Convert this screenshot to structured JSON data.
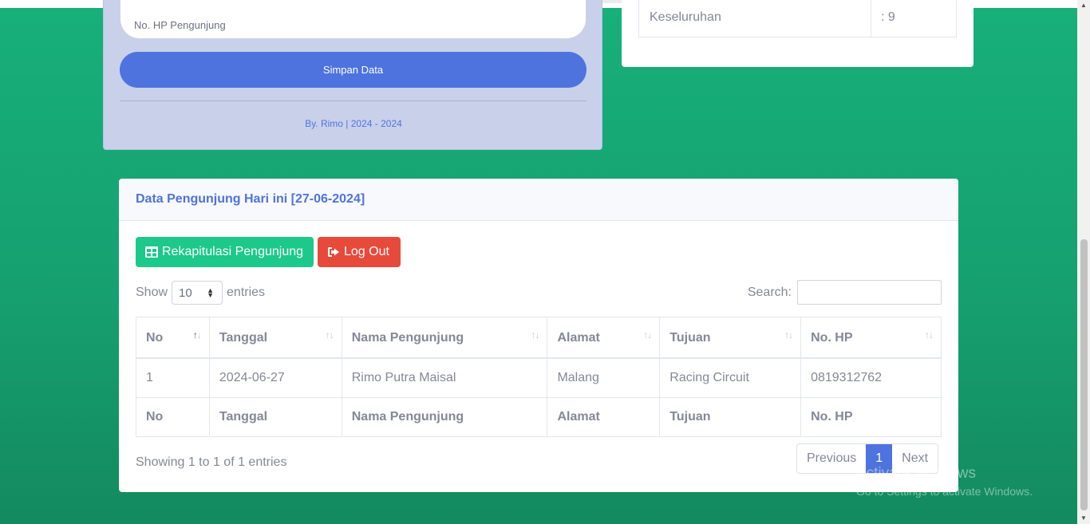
{
  "form": {
    "hp_placeholder": "No. HP Pengunjung",
    "submit_label": "Simpan Data",
    "footer": "By. Rimo | 2024 - 2024"
  },
  "stats": {
    "label": "Keseluruhan",
    "value": ": 9"
  },
  "data_card": {
    "title": "Data Pengunjung Hari ini [27-06-2024]",
    "rekap_button": "Rekapitulasi Pengunjung",
    "logout_button": "Log Out",
    "show_label": "Show",
    "entries_value": "10",
    "entries_label": "entries",
    "search_label": "Search:",
    "columns": [
      "No",
      "Tanggal",
      "Nama Pengunjung",
      "Alamat",
      "Tujuan",
      "No. HP"
    ],
    "rows": [
      [
        "1",
        "2024-06-27",
        "Rimo Putra Maisal",
        "Malang",
        "Racing Circuit",
        "0819312762"
      ]
    ],
    "info": "Showing 1 to 1 of 1 entries",
    "pager": {
      "previous": "Previous",
      "current": "1",
      "next": "Next"
    }
  },
  "watermark": {
    "line1": "Activate Windows",
    "line2": "Go to Settings to activate Windows."
  },
  "colors": {
    "primary": "#4e73df",
    "success": "#1cc88a",
    "danger": "#e74a3b",
    "background": "#16a070"
  }
}
